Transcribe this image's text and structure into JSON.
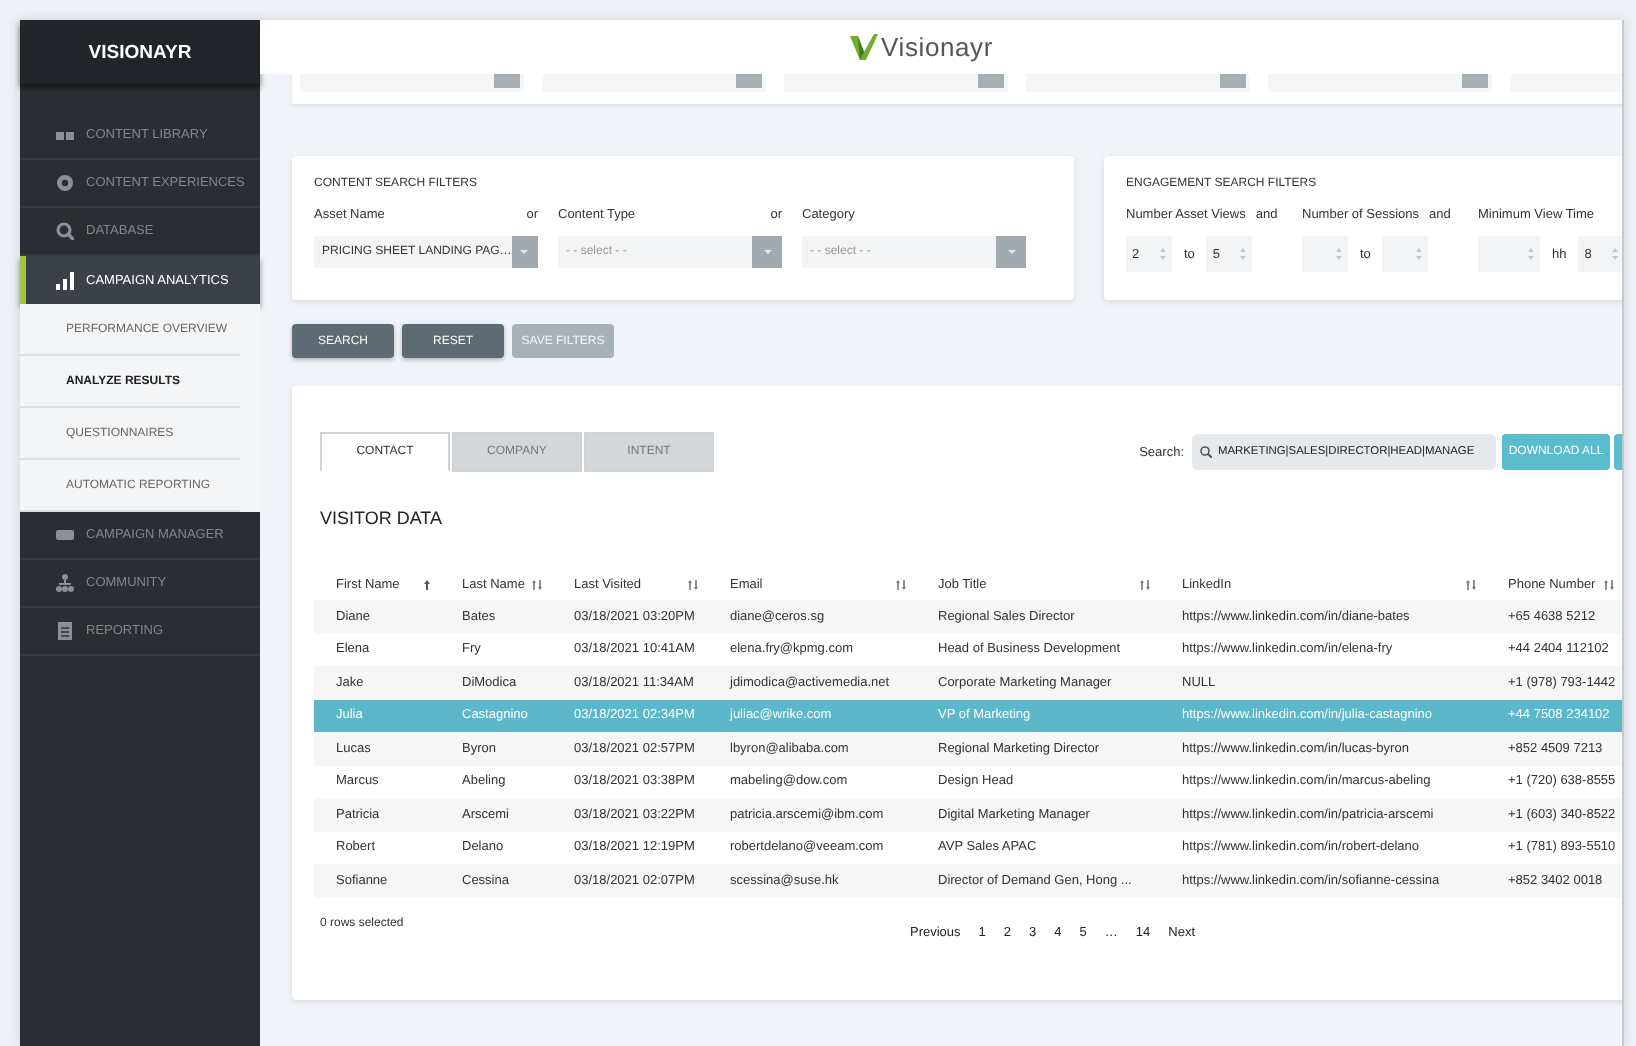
{
  "sidebar": {
    "brand": "VISIONAYR",
    "items": [
      {
        "label": "CONTENT LIBRARY",
        "selected": false
      },
      {
        "label": "CONTENT EXPERIENCES",
        "selected": false
      },
      {
        "label": "DATABASE",
        "selected": false
      },
      {
        "label": "CAMPAIGN ANALYTICS",
        "selected": true,
        "expanded": true,
        "children": [
          {
            "label": "PERFORMANCE OVERVIEW",
            "selected": false
          },
          {
            "label": "ANALYZE RESULTS",
            "selected": true
          },
          {
            "label": "QUESTIONNAIRES",
            "selected": false
          },
          {
            "label": "AUTOMATIC REPORTING",
            "selected": false
          }
        ]
      },
      {
        "label": "CAMPAIGN MANAGER",
        "selected": false
      },
      {
        "label": "COMMUNITY",
        "selected": false
      },
      {
        "label": "REPORTING",
        "selected": false
      }
    ]
  },
  "header": {
    "logo_text": "Visionayr"
  },
  "content_filters": {
    "title": "CONTENT SEARCH FILTERS",
    "fields": [
      {
        "label": "Asset Name",
        "joiner": "or",
        "value": "PRICING SHEET LANDING PAG…"
      },
      {
        "label": "Content Type",
        "joiner": "or",
        "placeholder": "- - select - -"
      },
      {
        "label": "Category",
        "placeholder": "- - select - -"
      }
    ]
  },
  "engagement_filters": {
    "title": "ENGAGEMENT SEARCH FILTERS",
    "groups": [
      {
        "label": "Number Asset Views",
        "joiner": "and",
        "separator": "to",
        "first": "2",
        "second": "5"
      },
      {
        "label": "Number of Sessions",
        "joiner": "and",
        "separator": "to"
      },
      {
        "label": "Minimum View Time",
        "separator": "hh",
        "second": "8"
      }
    ]
  },
  "buttons": [
    {
      "label": "SEARCH",
      "disabled": false
    },
    {
      "label": "RESET",
      "disabled": false
    },
    {
      "label": "SAVE FILTERS",
      "disabled": true
    }
  ],
  "results": {
    "tabs": [
      {
        "label": "CONTACT",
        "selected": true
      },
      {
        "label": "COMPANY",
        "selected": false
      },
      {
        "label": "INTENT",
        "selected": false
      }
    ],
    "search": {
      "label": "Search:",
      "value": "MARKETING|SALES|DIRECTOR|HEAD|MANAGE"
    },
    "download_button": "DOWNLOAD ALL",
    "heading": "VISITOR DATA",
    "table": {
      "columns": [
        {
          "label": "First Name",
          "sorted": true
        },
        {
          "label": "Last Name",
          "sorted": false
        },
        {
          "label": "Last Visited",
          "sorted": false
        },
        {
          "label": "Email",
          "sorted": false
        },
        {
          "label": "Job Title",
          "sorted": false
        },
        {
          "label": "LinkedIn",
          "sorted": false
        },
        {
          "label": "Phone Number",
          "sorted": false
        }
      ],
      "rows": [
        {
          "selected": false,
          "cells": [
            "Diane",
            "Bates",
            "03/18/2021 03:20PM",
            "diane@ceros.sg",
            "Regional Sales Director",
            "https://www.linkedin.com/in/diane-bates",
            "+65 4638 5212"
          ]
        },
        {
          "selected": false,
          "cells": [
            "Elena",
            "Fry",
            "03/18/2021 10:41AM",
            "elena.fry@kpmg.com",
            "Head of Business Development",
            "https://www.linkedin.com/in/elena-fry",
            "+44 2404 112102"
          ]
        },
        {
          "selected": false,
          "cells": [
            "Jake",
            "DiModica",
            "03/18/2021 11:34AM",
            "jdimodica@activemedia.net",
            "Corporate Marketing Manager",
            "NULL",
            "+1 (978) 793-1442"
          ]
        },
        {
          "selected": true,
          "cells": [
            "Julia",
            "Castagnino",
            "03/18/2021 02:34PM",
            "juliac@wrike.com",
            "VP of Marketing",
            "https://www.linkedin.com/in/julia-castagnino",
            "+44 7508 234102"
          ]
        },
        {
          "selected": false,
          "cells": [
            "Lucas",
            "Byron",
            "03/18/2021 02:57PM",
            "lbyron@alibaba.com",
            "Regional Marketing Director",
            "https://www.linkedin.com/in/lucas-byron",
            "+852 4509 7213"
          ]
        },
        {
          "selected": false,
          "cells": [
            "Marcus",
            "Abeling",
            "03/18/2021 03:38PM",
            "mabeling@dow.com",
            "Design Head",
            "https://www.linkedin.com/in/marcus-abeling",
            "+1 (720) 638-8555"
          ]
        },
        {
          "selected": false,
          "cells": [
            "Patricia",
            "Arscemi",
            "03/18/2021 03:22PM",
            "patricia.arscemi@ibm.com",
            "Digital Marketing Manager",
            "https://www.linkedin.com/in/patricia-arscemi",
            "+1 (603) 340-8522"
          ]
        },
        {
          "selected": false,
          "cells": [
            "Robert",
            "Delano",
            "03/18/2021 12:19PM",
            "robertdelano@veeam.com",
            "AVP Sales APAC",
            "https://www.linkedin.com/in/robert-delano",
            "+1 (781) 893-5510"
          ]
        },
        {
          "selected": false,
          "cells": [
            "Sofianne",
            "Cessina",
            "03/18/2021 02:07PM",
            "scessina@suse.hk",
            "Director of Demand Gen, Hong ...",
            "https://www.linkedin.com/in/sofianne-cessina",
            "+852 3402 0018"
          ]
        }
      ]
    },
    "selection_status": "0 rows selected",
    "pagination": {
      "previous": "Previous",
      "pages": [
        "1",
        "2",
        "3",
        "4",
        "5",
        "…",
        "14"
      ],
      "next": "Next"
    }
  }
}
